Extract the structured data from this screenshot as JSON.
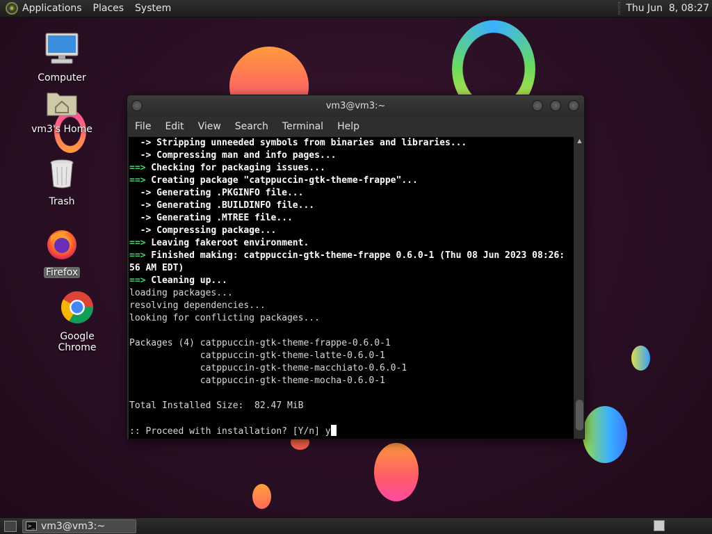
{
  "top_panel": {
    "menus": [
      "Applications",
      "Places",
      "System"
    ],
    "clock": "Thu Jun  8, 08:27"
  },
  "desktop": {
    "icons": [
      {
        "label": "Computer",
        "icon": "computer-icon"
      },
      {
        "label": "vm3's Home",
        "icon": "home-folder-icon"
      },
      {
        "label": "Trash",
        "icon": "trash-icon"
      },
      {
        "label": "Firefox",
        "icon": "firefox-icon"
      },
      {
        "label": "Google Chrome",
        "icon": "chrome-icon"
      }
    ]
  },
  "terminal": {
    "title": "vm3@vm3:~",
    "menu": [
      "File",
      "Edit",
      "View",
      "Search",
      "Terminal",
      "Help"
    ],
    "lines": [
      {
        "type": "sub",
        "text": "  -> Stripping unneeded symbols from binaries and libraries..."
      },
      {
        "type": "sub",
        "text": "  -> Compressing man and info pages..."
      },
      {
        "type": "main",
        "prefix": "==>",
        "text": " Checking for packaging issues..."
      },
      {
        "type": "main",
        "prefix": "==>",
        "text": " Creating package \"catppuccin-gtk-theme-frappe\"..."
      },
      {
        "type": "sub",
        "text": "  -> Generating .PKGINFO file..."
      },
      {
        "type": "sub",
        "text": "  -> Generating .BUILDINFO file..."
      },
      {
        "type": "sub",
        "text": "  -> Generating .MTREE file..."
      },
      {
        "type": "sub",
        "text": "  -> Compressing package..."
      },
      {
        "type": "main",
        "prefix": "==>",
        "text": " Leaving fakeroot environment."
      },
      {
        "type": "main",
        "prefix": "==>",
        "text": " Finished making: catppuccin-gtk-theme-frappe 0.6.0-1 (Thu 08 Jun 2023 08:26:"
      },
      {
        "type": "sub",
        "text": "56 AM EDT)"
      },
      {
        "type": "main",
        "prefix": "==>",
        "text": " Cleaning up..."
      },
      {
        "type": "plain",
        "text": "loading packages..."
      },
      {
        "type": "plain",
        "text": "resolving dependencies..."
      },
      {
        "type": "plain",
        "text": "looking for conflicting packages..."
      },
      {
        "type": "plain",
        "text": ""
      },
      {
        "type": "plain",
        "text": "Packages (4) catppuccin-gtk-theme-frappe-0.6.0-1"
      },
      {
        "type": "plain",
        "text": "             catppuccin-gtk-theme-latte-0.6.0-1"
      },
      {
        "type": "plain",
        "text": "             catppuccin-gtk-theme-macchiato-0.6.0-1"
      },
      {
        "type": "plain",
        "text": "             catppuccin-gtk-theme-mocha-0.6.0-1"
      },
      {
        "type": "plain",
        "text": ""
      },
      {
        "type": "plain",
        "text": "Total Installed Size:  82.47 MiB"
      },
      {
        "type": "plain",
        "text": ""
      },
      {
        "type": "prompt",
        "text": ":: Proceed with installation? [Y/n] y"
      }
    ]
  },
  "taskbar": {
    "window_button": "vm3@vm3:~"
  },
  "colors": {
    "arrow_green": "#3ed66b",
    "terminal_bg": "#000000"
  }
}
